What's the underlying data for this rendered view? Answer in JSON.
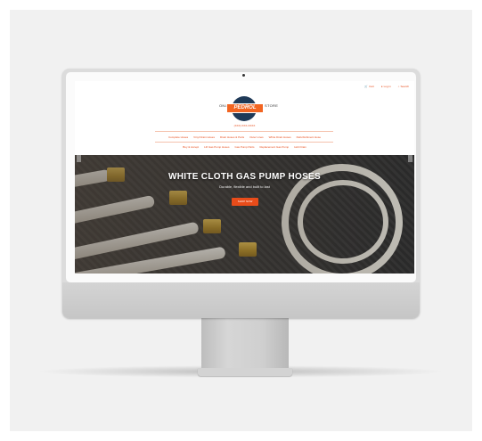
{
  "topbar": {
    "cart": "Cart",
    "account": "Log in",
    "search": "Search"
  },
  "logo": {
    "left_text": "ONLINE",
    "brand": "PEDROL",
    "right_text": "STORE",
    "phone": "(XXX) XXX-XXXX"
  },
  "nav_row1": [
    "Complete Hoses",
    "Vinyl Drain Hoses",
    "Drain Hoses & Parts",
    "Outer Lines",
    "White Drain Hoses",
    "Refurbishment Hose"
  ],
  "nav_row2": [
    "Buy & Accept",
    "Lift Gas Pump Hoses",
    "Gas Pump Parts",
    "Replacement Gas Pump",
    "Hob Drain"
  ],
  "hero": {
    "title": "WHITE CLOTH GAS PUMP HOSES",
    "subtitle": "Durable, flexible and built to last",
    "button": "SHOP NOW"
  },
  "colors": {
    "accent": "#e84c1a",
    "logo_navy": "#1f3a58",
    "logo_orange": "#f26522"
  }
}
